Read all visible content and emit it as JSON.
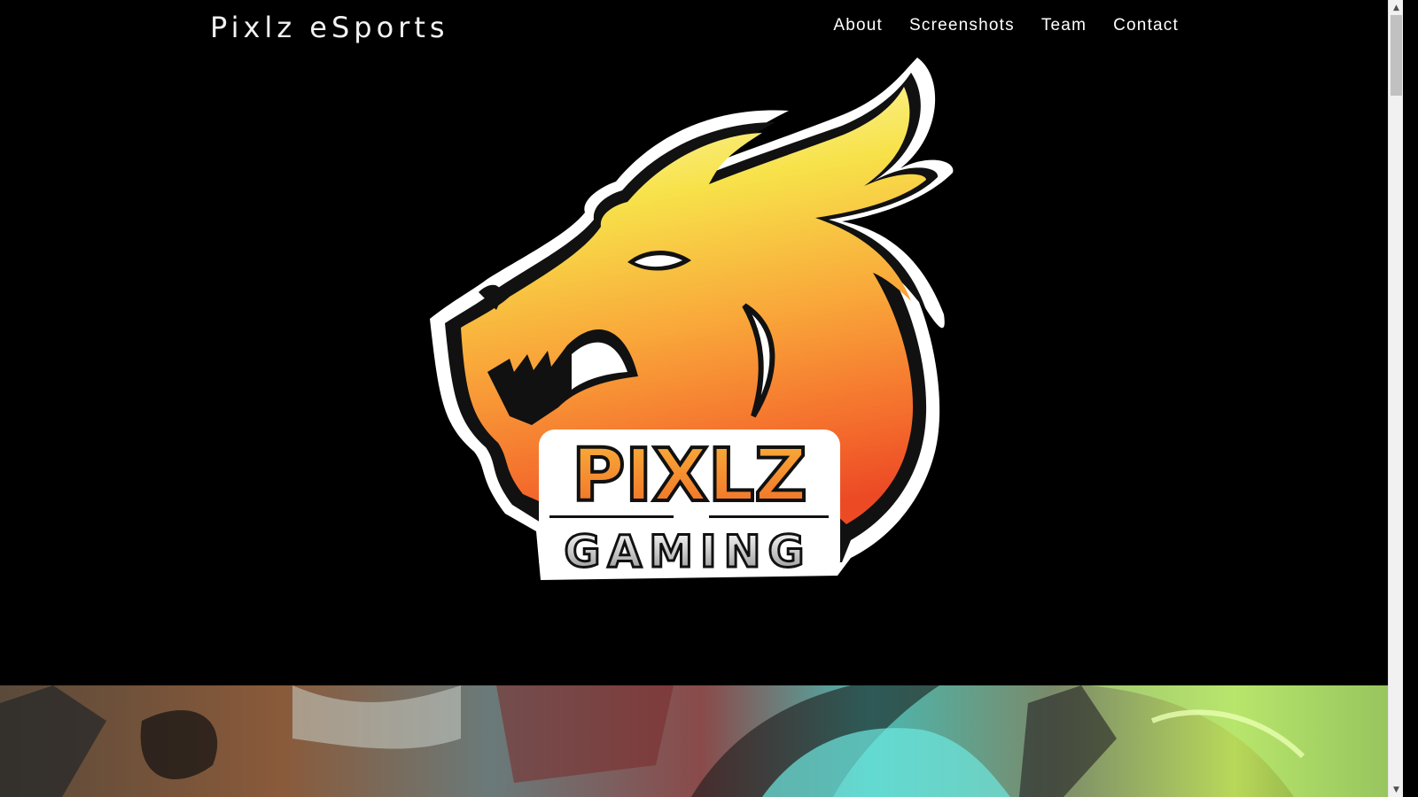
{
  "navbar": {
    "brand": "Pixlz eSports",
    "links": [
      {
        "label": "About"
      },
      {
        "label": "Screenshots"
      },
      {
        "label": "Team"
      },
      {
        "label": "Contact"
      }
    ]
  },
  "hero": {
    "logo": {
      "title": "PIXLZ",
      "subtitle": "GAMING",
      "description": "dragon head logo"
    }
  },
  "colors": {
    "background": "#000000",
    "nav_text": "#ffffff",
    "logo_yellow": "#f7e24a",
    "logo_orange": "#f5892e",
    "logo_red": "#ee5a2a"
  },
  "scrollbar": {
    "up_glyph": "▲",
    "down_glyph": "▼"
  }
}
